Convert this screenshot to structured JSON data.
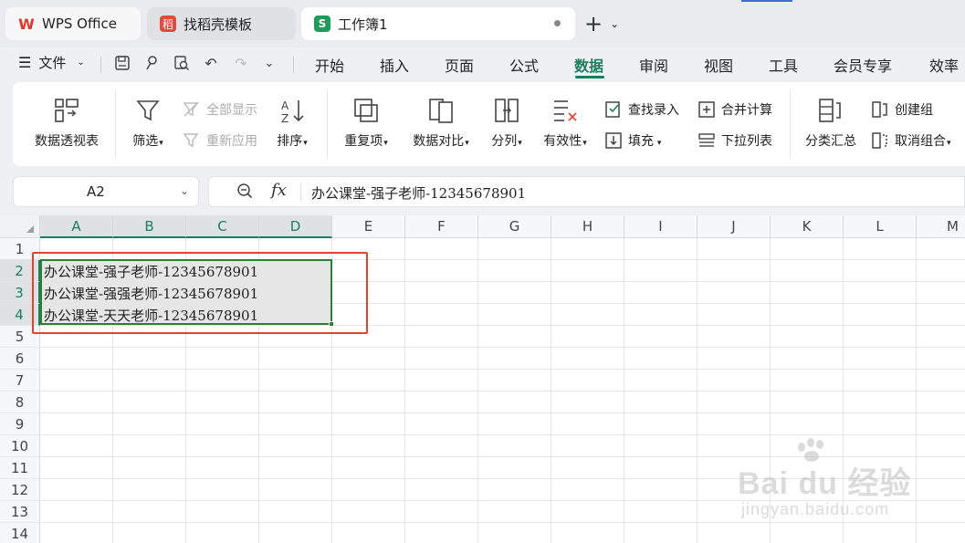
{
  "tabs": [
    {
      "label": "WPS Office"
    },
    {
      "label": "找稻壳模板"
    },
    {
      "label": "工作簿1"
    }
  ],
  "menu": {
    "file": "文件",
    "items": [
      "开始",
      "插入",
      "页面",
      "公式",
      "数据",
      "审阅",
      "视图",
      "工具",
      "会员专享",
      "效率"
    ],
    "active": "数据"
  },
  "ribbon": {
    "pivot": "数据透视表",
    "filter": "筛选",
    "show_all": "全部显示",
    "reapply": "重新应用",
    "sort": "排序",
    "duplicates": "重复项",
    "compare": "数据对比",
    "split": "分列",
    "validity": "有效性",
    "lookup_entry": "查找录入",
    "fill": "填充",
    "merge_calc": "合并计算",
    "dropdown_list": "下拉列表",
    "subtotal": "分类汇总",
    "create_group": "创建组",
    "ungroup": "取消组合"
  },
  "namebox": {
    "value": "A2"
  },
  "formula": {
    "fx": "fx",
    "content": "办公课堂-强子老师-12345678901"
  },
  "columns": [
    "A",
    "B",
    "C",
    "D",
    "E",
    "F",
    "G",
    "H",
    "I",
    "J",
    "K",
    "L",
    "M"
  ],
  "rows": [
    "1",
    "2",
    "3",
    "4",
    "5",
    "6",
    "7",
    "8",
    "9",
    "10",
    "11",
    "12",
    "13",
    "14"
  ],
  "cells": {
    "a2": "办公课堂-强子老师-12345678901",
    "a3": "办公课堂-强强老师-12345678901",
    "a4": "办公课堂-天天老师-12345678901"
  },
  "watermark": {
    "line1": "Bai du 经验",
    "line2": "jingyan.baidu.com"
  }
}
